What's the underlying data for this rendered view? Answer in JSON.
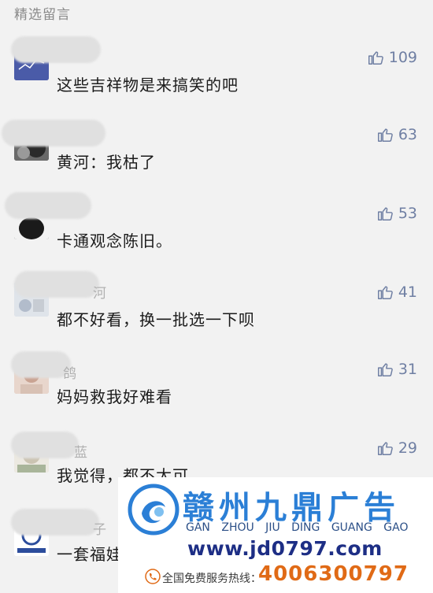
{
  "section_title": "精选留言",
  "comments": [
    {
      "name_suffix": "",
      "text": "这些吉祥物是来搞笑的吧",
      "likes": "109",
      "avatar_color": "#4a5ba8"
    },
    {
      "name_suffix": "",
      "text": "黄河：我枯了",
      "likes": "63",
      "avatar_color": "#3b3b3b"
    },
    {
      "name_suffix": "",
      "text": "卡通观念陈旧。",
      "likes": "53",
      "avatar_color": "#1f1f1f"
    },
    {
      "name_suffix": "河",
      "text": "都不好看，换一批选一下呗",
      "likes": "41",
      "avatar_color": "#c9d1dc"
    },
    {
      "name_suffix": "鸽",
      "text": "妈妈救我好难看",
      "likes": "31",
      "avatar_color": "#d7b9a9"
    },
    {
      "name_suffix": "蓝",
      "text": "我觉得，都不太可……",
      "likes": "29",
      "avatar_color": "#d8d4c8"
    },
    {
      "name_suffix": "子",
      "text": "一套福娃可以用一……",
      "likes": "",
      "avatar_color": "#2c4d9c"
    }
  ],
  "watermark": {
    "title": "赣州九鼎广告",
    "pinyin": "GAN ZHOU JIU DING GUANG GAO",
    "url": "www.jd0797.com",
    "hotline_label": "全国免费服务热线：",
    "hotline_number": "4006300797",
    "brand_color": "#2b7fd6",
    "phone_color": "#e06a16"
  }
}
